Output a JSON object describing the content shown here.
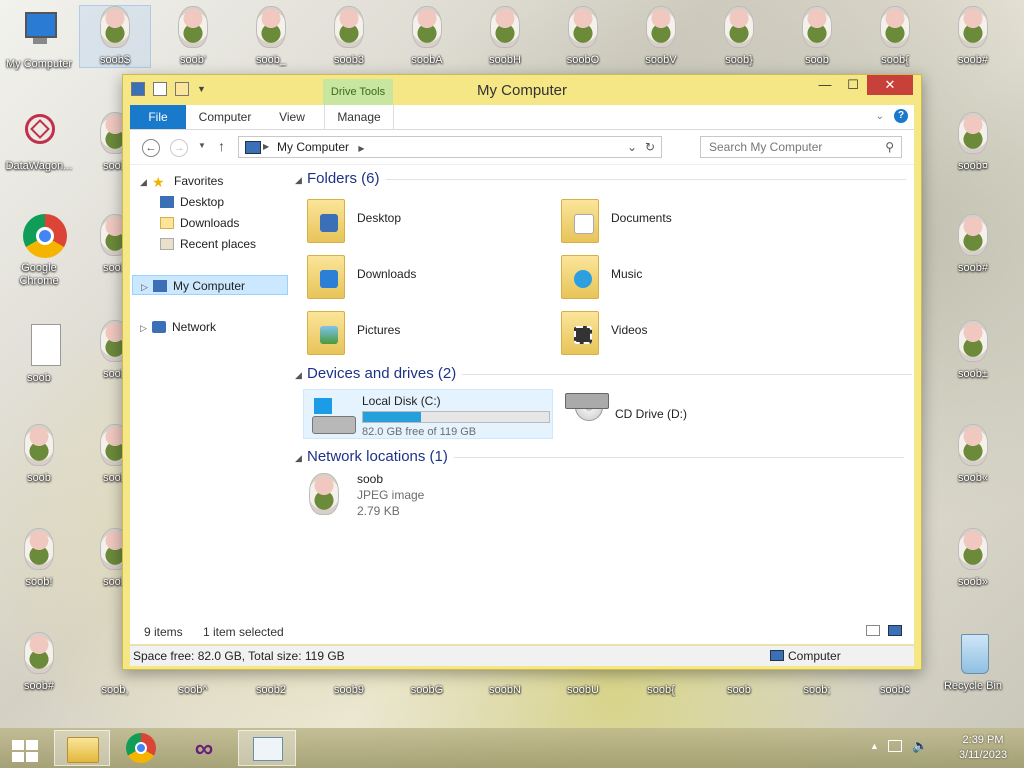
{
  "desktop": {
    "icons_left": [
      {
        "label": "My Computer"
      },
      {
        "label": "DataWagon..."
      },
      {
        "label": "Google Chrome"
      },
      {
        "label": "soob"
      },
      {
        "label": "soob"
      },
      {
        "label": "soob!"
      },
      {
        "label": "soob#"
      }
    ],
    "icons_top": [
      "soob$",
      "soob'",
      "soob_",
      "soob3",
      "soobA",
      "soobH",
      "soobO",
      "soobV",
      "soob}",
      "soob",
      "soob{",
      "soob#"
    ],
    "icons_bottom": [
      "soob,",
      "soob^",
      "soob2",
      "soob9",
      "soobG",
      "soobN",
      "soobU",
      "soob{",
      "soob",
      "soob;",
      "soob¢"
    ],
    "icons_right": [
      "soob¤",
      "soob#",
      "soob±",
      "soob«",
      "soob»"
    ],
    "icons_col2": [
      "soob",
      "soob",
      "soob",
      "soob",
      "soob"
    ],
    "recycle_bin": "Recycle Bin"
  },
  "window": {
    "title": "My Computer",
    "context_tab": "Drive Tools",
    "tabs": [
      "File",
      "Computer",
      "View",
      "Manage"
    ],
    "address": "My Computer",
    "search_placeholder": "Search My Computer",
    "nav": {
      "favorites": "Favorites",
      "desktop": "Desktop",
      "downloads": "Downloads",
      "recent": "Recent places",
      "my_computer": "My Computer",
      "network": "Network"
    },
    "groups": {
      "folders": "Folders (6)",
      "devices": "Devices and drives (2)",
      "network": "Network locations (1)"
    },
    "folders": [
      "Desktop",
      "Documents",
      "Downloads",
      "Music",
      "Pictures",
      "Videos"
    ],
    "drives": {
      "c_name": "Local Disk (C:)",
      "c_free": "82.0 GB free of 119 GB",
      "c_used_fraction": 0.31,
      "d_name": "CD Drive (D:)"
    },
    "network_item": {
      "name": "soob",
      "type": "JPEG image",
      "size": "2.79 KB"
    },
    "status": {
      "items": "9 items",
      "selected": "1 item selected"
    },
    "details": {
      "space": "Space free: 82.0 GB, Total size: 119 GB",
      "location": "Computer"
    }
  },
  "taskbar": {
    "time": "2:39 PM",
    "date": "3/11/2023"
  },
  "colors": {
    "window_frame": "#f5e686",
    "accent": "#1979ca",
    "group_header": "#1e3287",
    "disk_bar": "#26a0da"
  }
}
